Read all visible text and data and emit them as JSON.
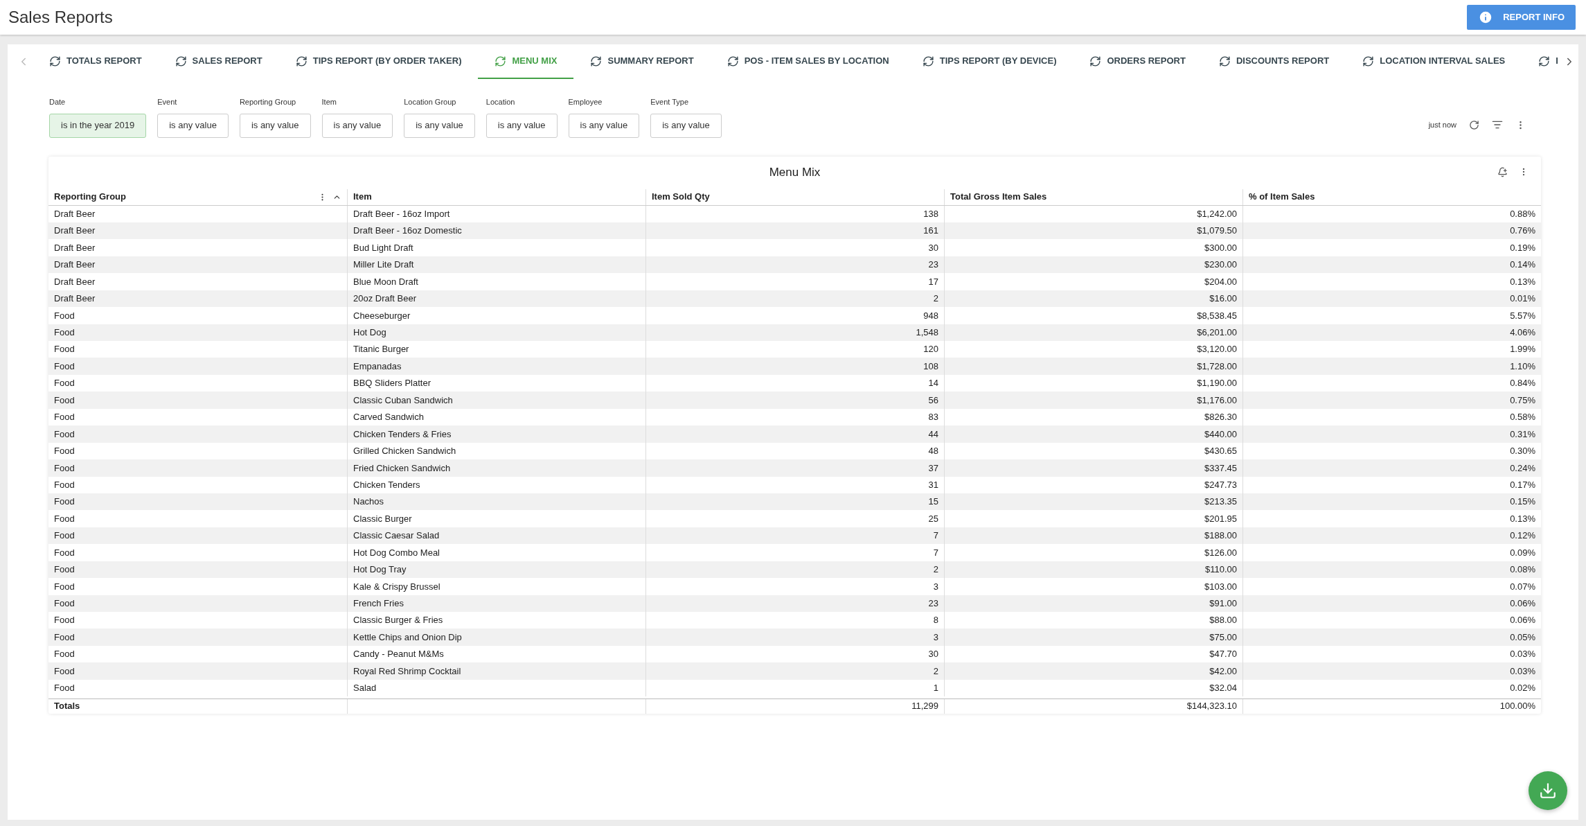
{
  "header": {
    "title": "Sales Reports",
    "report_info_button": "REPORT INFO"
  },
  "tabs": [
    {
      "label": "TOTALS REPORT",
      "selected": false
    },
    {
      "label": "SALES REPORT",
      "selected": false
    },
    {
      "label": "TIPS REPORT (BY ORDER TAKER)",
      "selected": false
    },
    {
      "label": "MENU MIX",
      "selected": true
    },
    {
      "label": "SUMMARY REPORT",
      "selected": false
    },
    {
      "label": "POS - ITEM SALES BY LOCATION",
      "selected": false
    },
    {
      "label": "TIPS REPORT (BY DEVICE)",
      "selected": false
    },
    {
      "label": "ORDERS REPORT",
      "selected": false
    },
    {
      "label": "DISCOUNTS REPORT",
      "selected": false
    },
    {
      "label": "LOCATION INTERVAL SALES",
      "selected": false
    },
    {
      "label": "I",
      "selected": false
    }
  ],
  "filters": [
    {
      "label": "Date",
      "value": "is in the year 2019",
      "active": true
    },
    {
      "label": "Event",
      "value": "is any value",
      "active": false
    },
    {
      "label": "Reporting Group",
      "value": "is any value",
      "active": false
    },
    {
      "label": "Item",
      "value": "is any value",
      "active": false
    },
    {
      "label": "Location Group",
      "value": "is any value",
      "active": false
    },
    {
      "label": "Location",
      "value": "is any value",
      "active": false
    },
    {
      "label": "Employee",
      "value": "is any value",
      "active": false
    },
    {
      "label": "Event Type",
      "value": "is any value",
      "active": false
    }
  ],
  "last_updated": "just now",
  "table": {
    "title": "Menu Mix",
    "columns": [
      "Reporting Group",
      "Item",
      "Item Sold Qty",
      "Total Gross Item Sales",
      "% of Item Sales"
    ],
    "rows": [
      [
        "Draft Beer",
        "Draft Beer - 16oz Import",
        "138",
        "$1,242.00",
        "0.88%"
      ],
      [
        "Draft Beer",
        "Draft Beer - 16oz Domestic",
        "161",
        "$1,079.50",
        "0.76%"
      ],
      [
        "Draft Beer",
        "Bud Light Draft",
        "30",
        "$300.00",
        "0.19%"
      ],
      [
        "Draft Beer",
        "Miller Lite Draft",
        "23",
        "$230.00",
        "0.14%"
      ],
      [
        "Draft Beer",
        "Blue Moon Draft",
        "17",
        "$204.00",
        "0.13%"
      ],
      [
        "Draft Beer",
        "20oz Draft Beer",
        "2",
        "$16.00",
        "0.01%"
      ],
      [
        "Food",
        "Cheeseburger",
        "948",
        "$8,538.45",
        "5.57%"
      ],
      [
        "Food",
        "Hot Dog",
        "1,548",
        "$6,201.00",
        "4.06%"
      ],
      [
        "Food",
        "Titanic Burger",
        "120",
        "$3,120.00",
        "1.99%"
      ],
      [
        "Food",
        "Empanadas",
        "108",
        "$1,728.00",
        "1.10%"
      ],
      [
        "Food",
        "BBQ Sliders Platter",
        "14",
        "$1,190.00",
        "0.84%"
      ],
      [
        "Food",
        "Classic Cuban Sandwich",
        "56",
        "$1,176.00",
        "0.75%"
      ],
      [
        "Food",
        "Carved Sandwich",
        "83",
        "$826.30",
        "0.58%"
      ],
      [
        "Food",
        "Chicken Tenders & Fries",
        "44",
        "$440.00",
        "0.31%"
      ],
      [
        "Food",
        "Grilled Chicken Sandwich",
        "48",
        "$430.65",
        "0.30%"
      ],
      [
        "Food",
        "Fried Chicken Sandwich",
        "37",
        "$337.45",
        "0.24%"
      ],
      [
        "Food",
        "Chicken Tenders",
        "31",
        "$247.73",
        "0.17%"
      ],
      [
        "Food",
        "Nachos",
        "15",
        "$213.35",
        "0.15%"
      ],
      [
        "Food",
        "Classic Burger",
        "25",
        "$201.95",
        "0.13%"
      ],
      [
        "Food",
        "Classic Caesar Salad",
        "7",
        "$188.00",
        "0.12%"
      ],
      [
        "Food",
        "Hot Dog Combo Meal",
        "7",
        "$126.00",
        "0.09%"
      ],
      [
        "Food",
        "Hot Dog Tray",
        "2",
        "$110.00",
        "0.08%"
      ],
      [
        "Food",
        "Kale & Crispy Brussel",
        "3",
        "$103.00",
        "0.07%"
      ],
      [
        "Food",
        "French Fries",
        "23",
        "$91.00",
        "0.06%"
      ],
      [
        "Food",
        "Classic Burger & Fries",
        "8",
        "$88.00",
        "0.06%"
      ],
      [
        "Food",
        "Kettle Chips and Onion Dip",
        "3",
        "$75.00",
        "0.05%"
      ],
      [
        "Food",
        "Candy - Peanut M&Ms",
        "30",
        "$47.70",
        "0.03%"
      ],
      [
        "Food",
        "Royal Red Shrimp Cocktail",
        "2",
        "$42.00",
        "0.03%"
      ],
      [
        "Food",
        "Salad",
        "1",
        "$32.04",
        "0.02%"
      ]
    ],
    "totals": {
      "label": "Totals",
      "values": [
        "11,299",
        "$144,323.10",
        "100.00%"
      ]
    }
  }
}
